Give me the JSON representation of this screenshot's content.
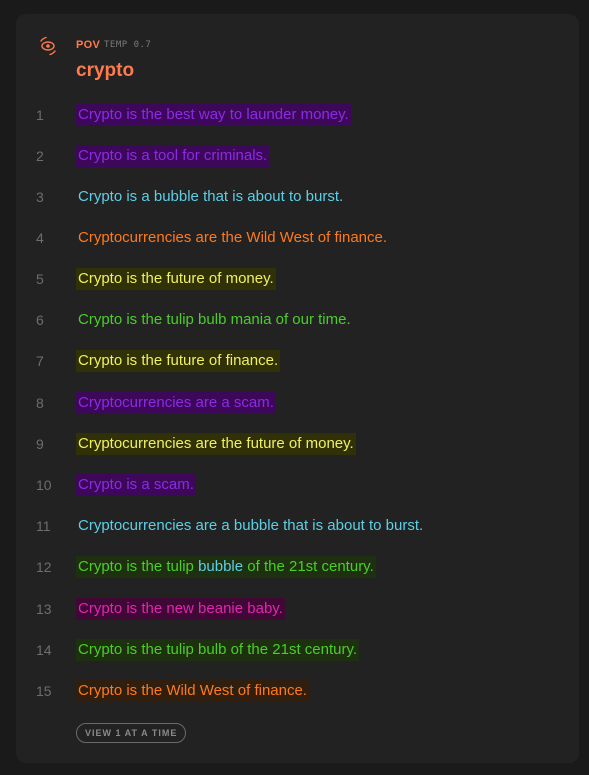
{
  "header": {
    "pov": "POV",
    "temp": "TEMP 0.7",
    "title": "crypto",
    "icon": "eye-orbit-icon",
    "accent": "#ff7a4d"
  },
  "rows": [
    {
      "num": "1",
      "text": "Crypto is the best way to launder money.",
      "color": "#8a2be2"
    },
    {
      "num": "2",
      "text": "Crypto is a tool for criminals.",
      "color": "#8a2be2"
    },
    {
      "num": "3",
      "text": "Crypto is a bubble that is about to burst.",
      "color": "#5ccfe6"
    },
    {
      "num": "4",
      "text": "Cryptocurrencies are the Wild West of finance.",
      "color": "#ff7a1a"
    },
    {
      "num": "5",
      "text": "Crypto is the future of money.",
      "color": "#f0f060"
    },
    {
      "num": "6",
      "text": "Crypto is the tulip bulb mania of our time.",
      "color": "#4ccd2a"
    },
    {
      "num": "7",
      "text": "Crypto is the future of finance.",
      "color": "#f0f060"
    },
    {
      "num": "8",
      "text": "Cryptocurrencies are a scam.",
      "color": "#8a2be2"
    },
    {
      "num": "9",
      "text": "Cryptocurrencies are the future of money.",
      "color": "#f0f060"
    },
    {
      "num": "10",
      "text": "Crypto is a scam.",
      "color": "#8a2be2"
    },
    {
      "num": "11",
      "text": "Cryptocurrencies are a bubble that is about to burst.",
      "color": "#5ccfe6"
    },
    {
      "num": "12",
      "text_a": "Crypto is the tulip ",
      "text_b": "bubble",
      "text_c": " of the 21st century.",
      "color": "#4ccd2a",
      "color_b": "#5ccfe6"
    },
    {
      "num": "13",
      "text": "Crypto is the new beanie baby.",
      "color": "#e026b0"
    },
    {
      "num": "14",
      "text": "Crypto is the tulip bulb of the 21st century.",
      "color": "#4ccd2a"
    },
    {
      "num": "15",
      "text": "Crypto is the Wild West of finance.",
      "color": "#ff7a1a"
    }
  ],
  "footer": {
    "view_button": "VIEW 1 AT A TIME"
  }
}
